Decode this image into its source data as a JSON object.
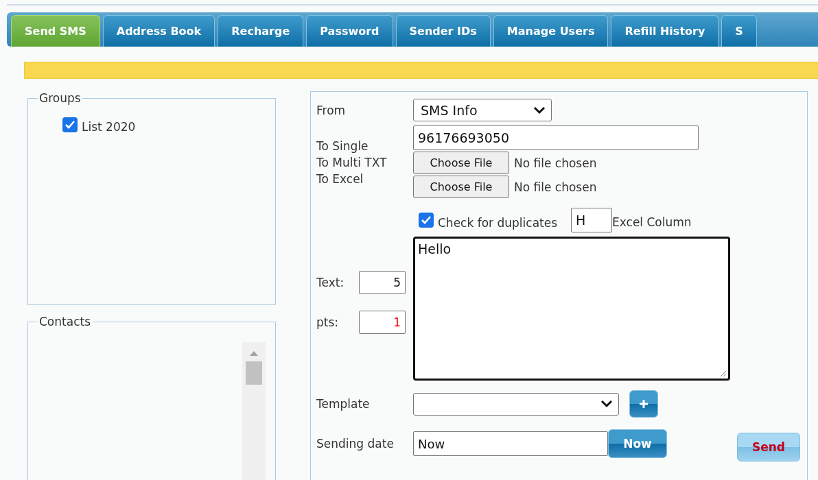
{
  "tabs": [
    {
      "label": "Send SMS",
      "selected": true
    },
    {
      "label": "Address Book",
      "selected": false
    },
    {
      "label": "Recharge",
      "selected": false
    },
    {
      "label": "Password",
      "selected": false
    },
    {
      "label": "Sender IDs",
      "selected": false
    },
    {
      "label": "Manage Users",
      "selected": false
    },
    {
      "label": "Refill History",
      "selected": false
    },
    {
      "label": "S",
      "selected": false
    }
  ],
  "groups": {
    "title": "Groups",
    "items": [
      {
        "label": "List 2020",
        "checked": true
      }
    ]
  },
  "contacts": {
    "title": "Contacts"
  },
  "form": {
    "from": {
      "label": "From",
      "value": "SMS Info"
    },
    "to_single": {
      "label": "To Single",
      "value": "96176693050"
    },
    "to_multi_txt": {
      "label": "To Multi TXT",
      "button": "Choose File",
      "status": "No file chosen"
    },
    "to_excel": {
      "label": "To Excel",
      "button": "Choose File",
      "status": "No file chosen"
    },
    "duplicates": {
      "label": "Check for duplicates",
      "checked": true
    },
    "excel_column": {
      "value": "H",
      "label": "Excel Column"
    },
    "message": {
      "value": "Hello"
    },
    "text_count": {
      "label": "Text:",
      "value": "5"
    },
    "parts": {
      "label": "pts:",
      "value": "1"
    },
    "template": {
      "label": "Template"
    },
    "sending_date": {
      "label": "Sending date",
      "value": "Now",
      "button": "Now"
    },
    "send_button": "Send"
  }
}
